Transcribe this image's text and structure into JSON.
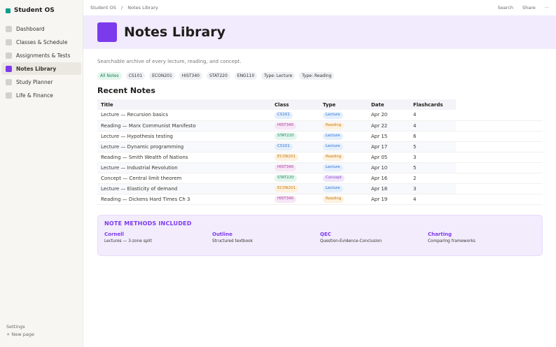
{
  "sidebar": {
    "workspace": "Student OS",
    "items": [
      {
        "label": "Dashboard",
        "active": false
      },
      {
        "label": "Classes & Schedule",
        "active": false
      },
      {
        "label": "Assignments & Tests",
        "active": false
      },
      {
        "label": "Notes Library",
        "active": true
      },
      {
        "label": "Study Planner",
        "active": false
      },
      {
        "label": "Life & Finance",
        "active": false
      }
    ],
    "settings": "Settings",
    "new_page": "+  New page"
  },
  "topbar": {
    "breadcrumb": [
      "Student OS",
      "Notes Library"
    ],
    "separator": "/",
    "actions": {
      "search": "Search",
      "share": "Share",
      "more": "···"
    }
  },
  "page": {
    "title": "Notes Library",
    "description": "Searchable archive of every lecture, reading, and concept.",
    "accent": "#7c3aed"
  },
  "filters": [
    "All Notes",
    "CS101",
    "ECON201",
    "HIST340",
    "STAT220",
    "ENG110",
    "Type: Lecture",
    "Type: Reading"
  ],
  "section_title": "Recent Notes",
  "table": {
    "columns": [
      "Title",
      "Class",
      "Type",
      "Date",
      "Flashcards"
    ],
    "rows": [
      {
        "title": "Lecture — Recursion basics",
        "class": "CS101",
        "type": "Lecture",
        "date": "Apr 20",
        "cards": "4"
      },
      {
        "title": "Reading — Marx Communist Manifesto",
        "class": "HIST340",
        "type": "Reading",
        "date": "Apr 22",
        "cards": "4"
      },
      {
        "title": "Lecture — Hypothesis testing",
        "class": "STAT220",
        "type": "Lecture",
        "date": "Apr 15",
        "cards": "6"
      },
      {
        "title": "Lecture — Dynamic programming",
        "class": "CS101",
        "type": "Lecture",
        "date": "Apr 17",
        "cards": "5"
      },
      {
        "title": "Reading — Smith Wealth of Nations",
        "class": "ECON201",
        "type": "Reading",
        "date": "Apr 05",
        "cards": "3"
      },
      {
        "title": "Lecture — Industrial Revolution",
        "class": "HIST340",
        "type": "Lecture",
        "date": "Apr 10",
        "cards": "5"
      },
      {
        "title": "Concept — Central limit theorem",
        "class": "STAT220",
        "type": "Concept",
        "date": "Apr 16",
        "cards": "2"
      },
      {
        "title": "Lecture — Elasticity of demand",
        "class": "ECON201",
        "type": "Lecture",
        "date": "Apr 18",
        "cards": "3"
      },
      {
        "title": "Reading — Dickens Hard Times Ch 3",
        "class": "HIST340",
        "type": "Reading",
        "date": "Apr 19",
        "cards": "4"
      }
    ]
  },
  "tag_colors": {
    "CS101": {
      "bg": "#e3effd",
      "fg": "#2f6fcf"
    },
    "HIST340": {
      "bg": "#f7e6f5",
      "fg": "#a63b9e"
    },
    "STAT220": {
      "bg": "#e3f6ee",
      "fg": "#1a8a5a"
    },
    "ECON201": {
      "bg": "#fdf1de",
      "fg": "#c77a12"
    },
    "Lecture": {
      "bg": "#e3effd",
      "fg": "#2f6fcf"
    },
    "Reading": {
      "bg": "#fdf1de",
      "fg": "#c77a12"
    },
    "Concept": {
      "bg": "#f0e6fb",
      "fg": "#8a3fd1"
    }
  },
  "callout": {
    "title": "NOTE METHODS INCLUDED",
    "methods": [
      {
        "name": "Cornell",
        "desc": "Lectures — 3-zone split"
      },
      {
        "name": "Outline",
        "desc": "Structured textbook"
      },
      {
        "name": "QEC",
        "desc": "Question-Evidence-Conclusion"
      },
      {
        "name": "Charting",
        "desc": "Comparing frameworks"
      }
    ]
  }
}
